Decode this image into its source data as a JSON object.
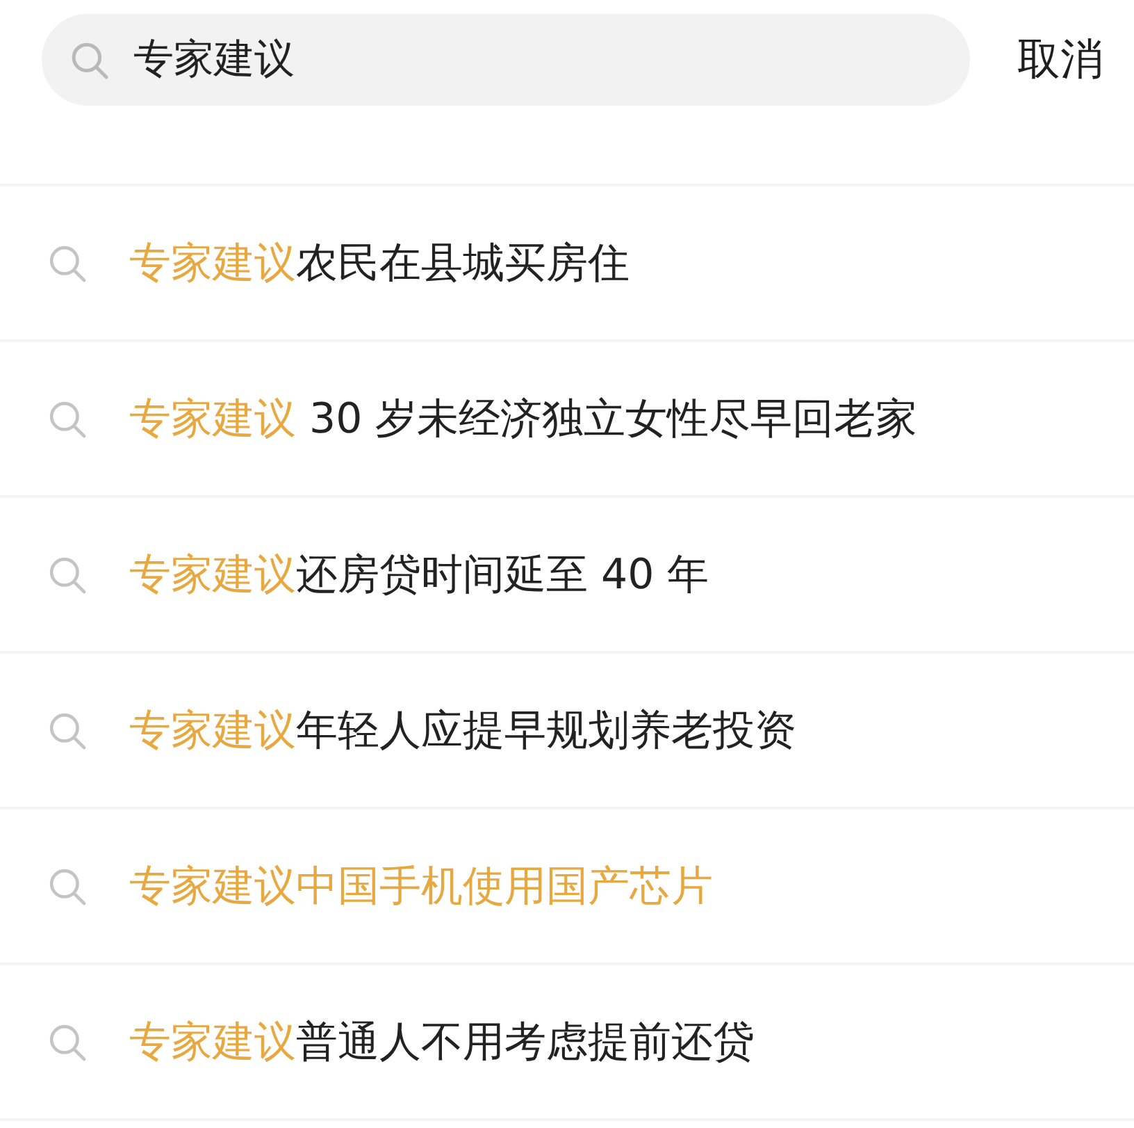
{
  "search": {
    "value": "专家建议"
  },
  "cancel": "取消",
  "suggestions": [
    {
      "highlight": "专家建议",
      "rest": "农民在县城买房住"
    },
    {
      "highlight": "专家建议",
      "rest": " 30 岁未经济独立女性尽早回老家"
    },
    {
      "highlight": "专家建议",
      "rest": "还房贷时间延至 40 年"
    },
    {
      "highlight": "专家建议",
      "rest": "年轻人应提早规划养老投资"
    },
    {
      "highlight": "专家建议中国手机使用国产芯片"
    },
    {
      "highlight": "专家建议",
      "rest": "普通人不用考虑提前还贷"
    }
  ]
}
